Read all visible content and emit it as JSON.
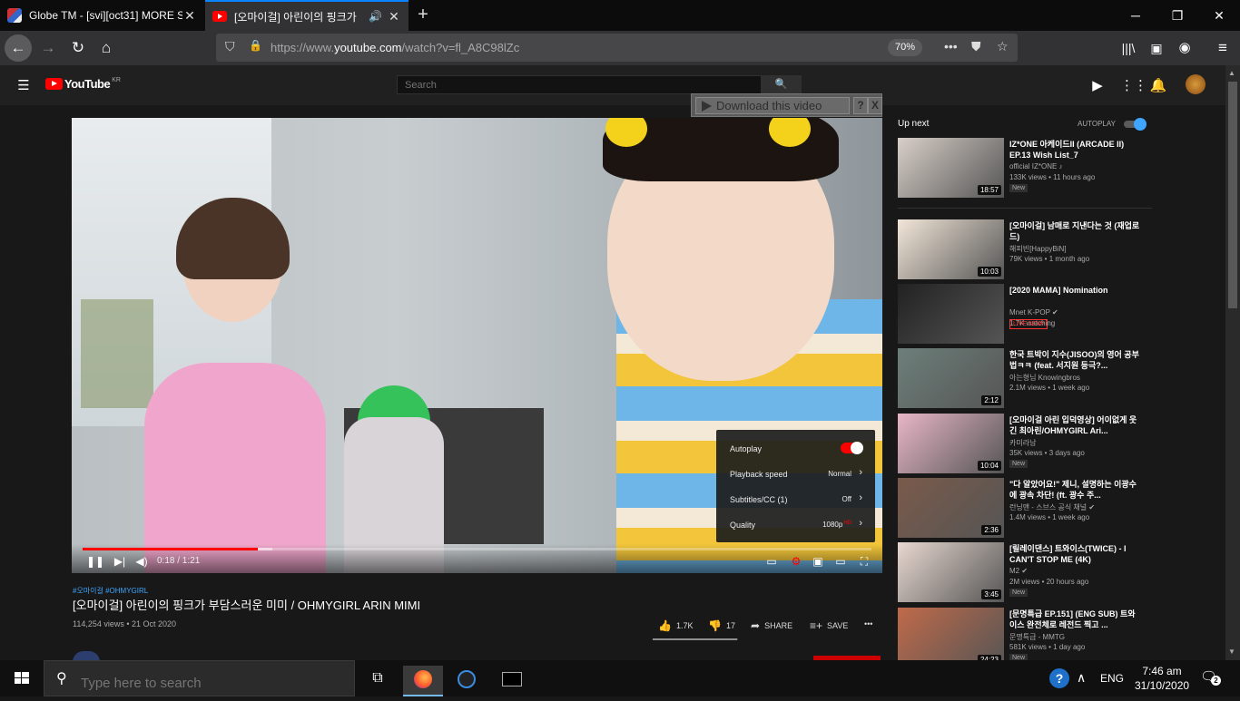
{
  "browser": {
    "tabs": [
      {
        "title": "Globe TM - [svi][oct31] MORE S",
        "active": false
      },
      {
        "title": "[오마이걸] 아린이의 핑크가",
        "active": true
      }
    ],
    "url_prefix": "https://www.",
    "url_domain": "youtube.com",
    "url_path": "/watch?v=fl_A8C98lZc",
    "zoom": "70%"
  },
  "youtube": {
    "logo_text": "YouTube",
    "country": "KR",
    "search_placeholder": "Search"
  },
  "download_bar": {
    "label": "Download this video",
    "help": "?",
    "close": "X"
  },
  "player": {
    "time": "0:18 / 1:21",
    "progress": 0.222,
    "buffered": 0.24,
    "settings": {
      "autoplay_label": "Autoplay",
      "autoplay_on": true,
      "speed_label": "Playback speed",
      "speed_value": "Normal",
      "subs_label": "Subtitles/CC (1)",
      "subs_value": "Off",
      "quality_label": "Quality",
      "quality_value": "1080p",
      "quality_badge": "HD"
    }
  },
  "video": {
    "hashtags": "#오마이걸 #OHMYGIRL",
    "title": "[오마이걸] 아린이의 핑크가 부담스러운 미미 / OHMYGIRL ARIN MIMI",
    "meta": "114,254 views • 21 Oct 2020",
    "likes": "1.7K",
    "dislikes": "17",
    "like_ratio": 0.99,
    "share": "SHARE",
    "save": "SAVE",
    "more": "•••"
  },
  "sidebar": {
    "up_next": "Up next",
    "autoplay": "AUTOPLAY",
    "items": [
      {
        "title": "IZ*ONE 아케이드II (ARCADE II) EP.13 Wish List_7",
        "channel": "official IZ*ONE ♪",
        "views": "133K views • 11 hours ago",
        "badge": "New",
        "duration": "18:57",
        "thumb_color": "#d8cfc8"
      },
      {
        "title": "[오마이걸] 남매로 지낸다는 것 (재업로드)",
        "channel": "해피빈[HappyBiN]",
        "views": "79K views • 1 month ago",
        "badge": "",
        "duration": "10:03",
        "thumb_color": "#f2e6d8"
      },
      {
        "title": "[2020 MAMA] Nomination",
        "channel": "Mnet K-POP ✔",
        "views": "1.7K watching",
        "badge": "LIVE NOW",
        "duration": "",
        "thumb_color": "#222222"
      },
      {
        "title": "한국 트박이 지수(JISOO)의 영어 공부법ㅋㅋ (feat. 서지원 등극?...",
        "channel": "아는형님 Knowingbros",
        "views": "2.1M views • 1 week ago",
        "badge": "",
        "duration": "2:12",
        "thumb_color": "#6d7f7a"
      },
      {
        "title": "[오마이걸 아린 입덕영상] 어이없게 웃긴 최아린/OHMYGIRL Ari...",
        "channel": "카미라남",
        "views": "35K views • 3 days ago",
        "badge": "New",
        "duration": "10:04",
        "thumb_color": "#e8b6c6"
      },
      {
        "title": "\"다 알았어요!\" 제니, 설명하는 이광수에 광속 차단! (ft. 광수 주...",
        "channel": "런닝맨 - 스브스 공식 채널 ✔",
        "views": "1.4M views • 1 week ago",
        "badge": "",
        "duration": "2:36",
        "thumb_color": "#7a5a4a"
      },
      {
        "title": "[릴레이댄스] 트와이스(TWICE) - I CAN'T STOP ME (4K)",
        "channel": "M2 ✔",
        "views": "2M views • 20 hours ago",
        "badge": "New",
        "duration": "3:45",
        "thumb_color": "#e8d8d0"
      },
      {
        "title": "[문명특급 EP.151] (ENG SUB) 트와이스 완전체로 레전드 찍고 ...",
        "channel": "문명특급 - MMTG",
        "views": "581K views • 1 day ago",
        "badge": "New",
        "duration": "24:23",
        "thumb_color": "#c06a4a"
      }
    ]
  },
  "taskbar": {
    "search_placeholder": "Type here to search",
    "lang": "ENG",
    "time": "7:46 am",
    "date": "31/10/2020",
    "notifications": "2"
  }
}
